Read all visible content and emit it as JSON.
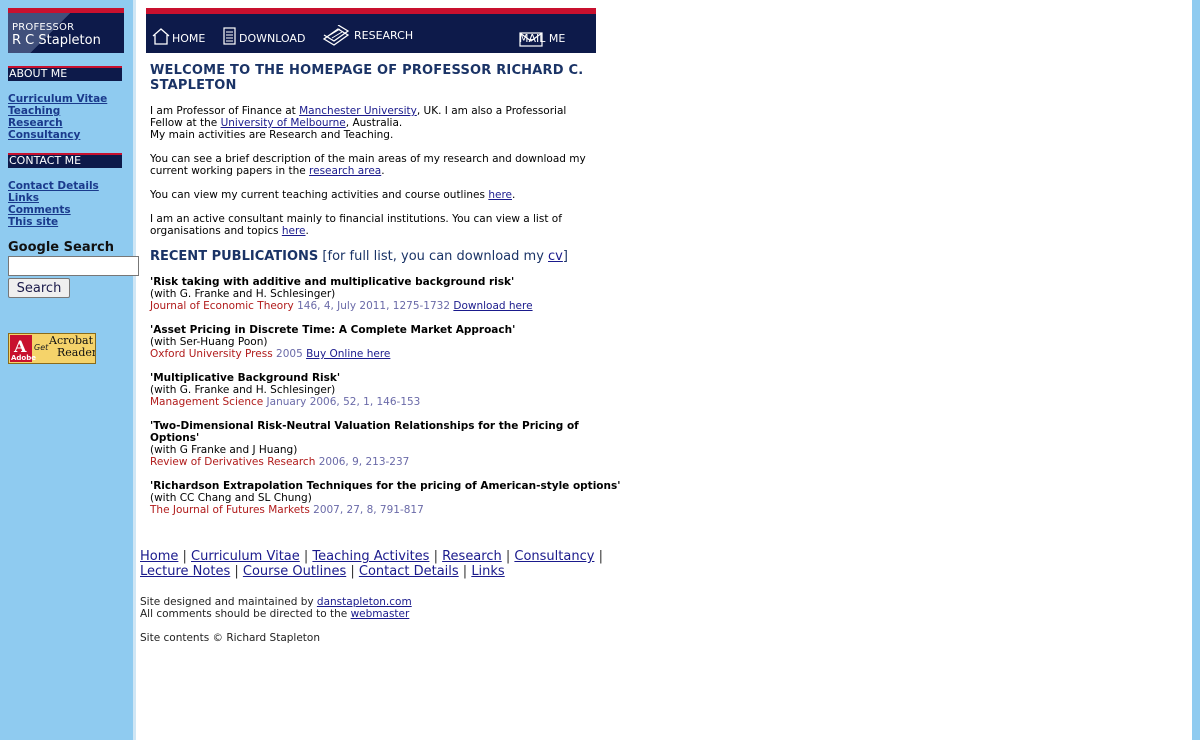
{
  "sidebar": {
    "logo_line1": "PROFESSOR",
    "logo_line2": "R C Stapleton",
    "about_heading": "ABOUT ME",
    "about_links": [
      "Curriculum Vitae",
      "Teaching",
      "Research",
      "Consultancy"
    ],
    "contact_heading": "CONTACT ME",
    "contact_links": [
      "Contact Details",
      "Links",
      "Comments",
      "This site"
    ],
    "google_title": "Google Search",
    "search_button": "Search",
    "search_value": "",
    "acrobat_get": "Get",
    "acrobat_name_line1": "Acrobat",
    "acrobat_name_line2": "Reader",
    "acrobat_adobe": "Adobe"
  },
  "topnav": {
    "home": "HOME",
    "download": "DOWNLOAD",
    "research": "RESEARCH",
    "mail": "MAIL ME"
  },
  "main": {
    "welcome": "WELCOME TO THE HOMEPAGE OF PROFESSOR RICHARD C. STAPLETON",
    "intro_1a": "I am Professor of Finance at ",
    "intro_link_manchester": "Manchester University",
    "intro_1b": ", UK. I am also a Professorial Fellow at the ",
    "intro_link_melbourne": "University of Melbourne",
    "intro_1c": ", Australia.",
    "intro_2": "My main activities are Research and Teaching.",
    "research_a": "You can see a brief description of the main areas of my research and download my current working papers in the ",
    "research_link": "research area",
    "research_b": ".",
    "teaching_a": "You can view my current teaching activities and course outlines ",
    "teaching_link": "here",
    "teaching_b": ".",
    "consult_a": "I am an active consultant mainly to financial institutions. You can view a list of organisations and topics ",
    "consult_link": "here",
    "consult_b": ".",
    "recent_title": "RECENT PUBLICATIONS",
    "recent_note_a": " [for full list, you can download my ",
    "recent_note_link": "cv",
    "recent_note_b": "]",
    "publications": [
      {
        "title": "'Risk taking with additive and multiplicative background risk'",
        "authors": "(with G. Franke and H. Schlesinger)",
        "journal": "Journal of Economic Theory",
        "details": " 146, 4, July 2011, 1275-1732",
        "link": "Download here"
      },
      {
        "title": "'Asset Pricing in Discrete Time: A Complete Market Approach'",
        "authors": "(with Ser-Huang Poon)",
        "journal": "Oxford University Press",
        "details": " 2005",
        "link": "Buy Online here"
      },
      {
        "title": "'Multiplicative Background Risk'",
        "authors": "(with G. Franke and H. Schlesinger)",
        "journal": "Management Science",
        "details": " January 2006, 52, 1, 146-153",
        "link": ""
      },
      {
        "title": "'Two-Dimensional Risk-Neutral Valuation Relationships for the Pricing of Options'",
        "authors": "(with G Franke and J Huang)",
        "journal": "Review of Derivatives Research",
        "details": " 2006, 9, 213-237",
        "link": ""
      },
      {
        "title": "'Richardson Extrapolation Techniques for the pricing of American-style options'",
        "authors": "(with CC Chang and SL Chung)",
        "journal": "The Journal of Futures Markets",
        "details": " 2007, 27, 8, 791-817",
        "link": ""
      }
    ]
  },
  "footer": {
    "links": [
      "Home",
      "Curriculum Vitae",
      "Teaching Activites",
      "Research",
      "Consultancy",
      "Lecture Notes",
      "Course Outlines",
      "Contact Details",
      "Links"
    ],
    "separator": " | ",
    "designed_a": "Site designed and maintained by ",
    "designed_link": "danstapleton.com",
    "comments_a": "All comments should be directed to the ",
    "comments_link": "webmaster",
    "copyright": "Site contents © Richard Stapleton"
  },
  "colors": {
    "navy": "#0d1a4a",
    "red": "#c8102e",
    "sidebar_bg": "#8fcbf0",
    "heading_blue": "#1a3366",
    "journal_red": "#b01a1a",
    "details_purple": "#6a6aa8"
  },
  "icons": [
    "house-icon",
    "document-icon",
    "books-icon",
    "envelope-icon",
    "acrobat-icon"
  ]
}
